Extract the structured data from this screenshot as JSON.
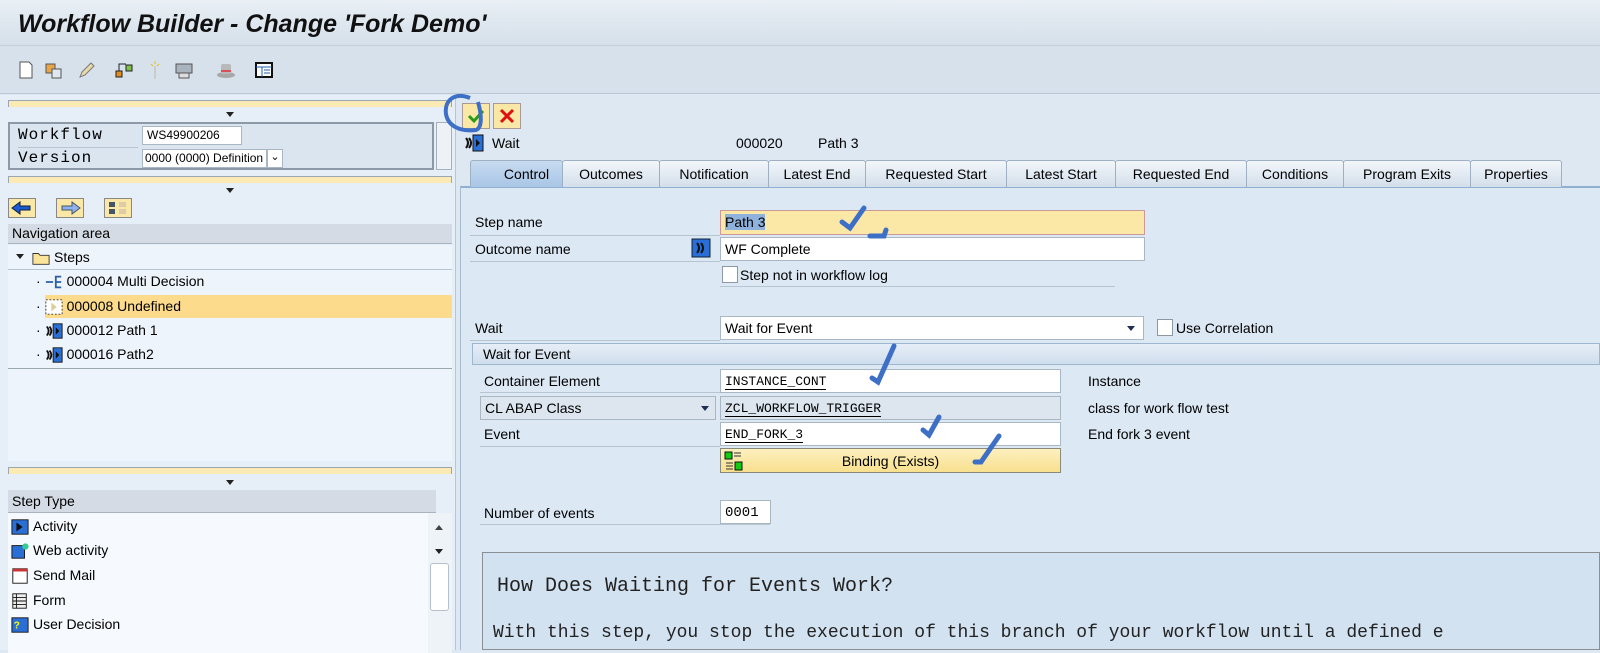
{
  "window": {
    "title": "Workflow Builder - Change 'Fork Demo'"
  },
  "toolbar": {
    "icons": [
      "new-document-icon",
      "copy-icon",
      "edit-pencil-icon",
      "hierarchy-icon",
      "magic-wand-icon",
      "printer-icon",
      "hat-icon",
      "layout-icon"
    ]
  },
  "workflow_header": {
    "workflow_label": "Workflow",
    "workflow_value": "WS49900206",
    "version_label": "Version",
    "version_value": "0000 (0000) Definition"
  },
  "navigation": {
    "title": "Navigation area",
    "root": "Steps",
    "items": [
      {
        "label": "000004 Multi Decision",
        "icon": "multi-decision-icon"
      },
      {
        "label": "000008 Undefined",
        "icon": "undefined-step-icon",
        "selected": true
      },
      {
        "label": "000012 Path 1",
        "icon": "wait-step-icon"
      },
      {
        "label": "000016 Path2",
        "icon": "wait-step-icon"
      }
    ]
  },
  "step_types": {
    "title": "Step Type",
    "items": [
      "Activity",
      "Web activity",
      "Send Mail",
      "Form",
      "User Decision"
    ]
  },
  "step": {
    "type": "Wait",
    "number": "000020",
    "name": "Path 3"
  },
  "tabs": [
    "Control",
    "Outcomes",
    "Notification",
    "Latest End",
    "Requested Start",
    "Latest Start",
    "Requested End",
    "Conditions",
    "Program Exits",
    "Properties"
  ],
  "form": {
    "step_name_label": "Step name",
    "step_name_value": "Path 3",
    "outcome_label": "Outcome name",
    "outcome_value": "WF Complete",
    "not_in_log_label": "Step not in workflow log",
    "wait_label": "Wait",
    "wait_value": "Wait for Event",
    "use_correlation_label": "Use Correlation",
    "group_title": "Wait for Event",
    "container_label": "Container Element",
    "container_value": "INSTANCE_CONT",
    "container_desc": "Instance",
    "object_type_value": "CL ABAP Class",
    "class_value": "ZCL_WORKFLOW_TRIGGER",
    "class_desc": "class for work flow test",
    "event_label": "Event",
    "event_value": "END_FORK_3",
    "event_desc": "End fork 3 event",
    "binding_label": "Binding (Exists)",
    "num_events_label": "Number of events",
    "num_events_value": "0001"
  },
  "help": {
    "title": "How Does Waiting for Events Work?",
    "text": "With this step, you stop the execution of this branch of your workflow until a defined e"
  },
  "colors": {
    "accent_yellow": "#fbe8a6",
    "selected_row": "#fcdc8c",
    "annotation_blue": "#3d6fc7"
  }
}
